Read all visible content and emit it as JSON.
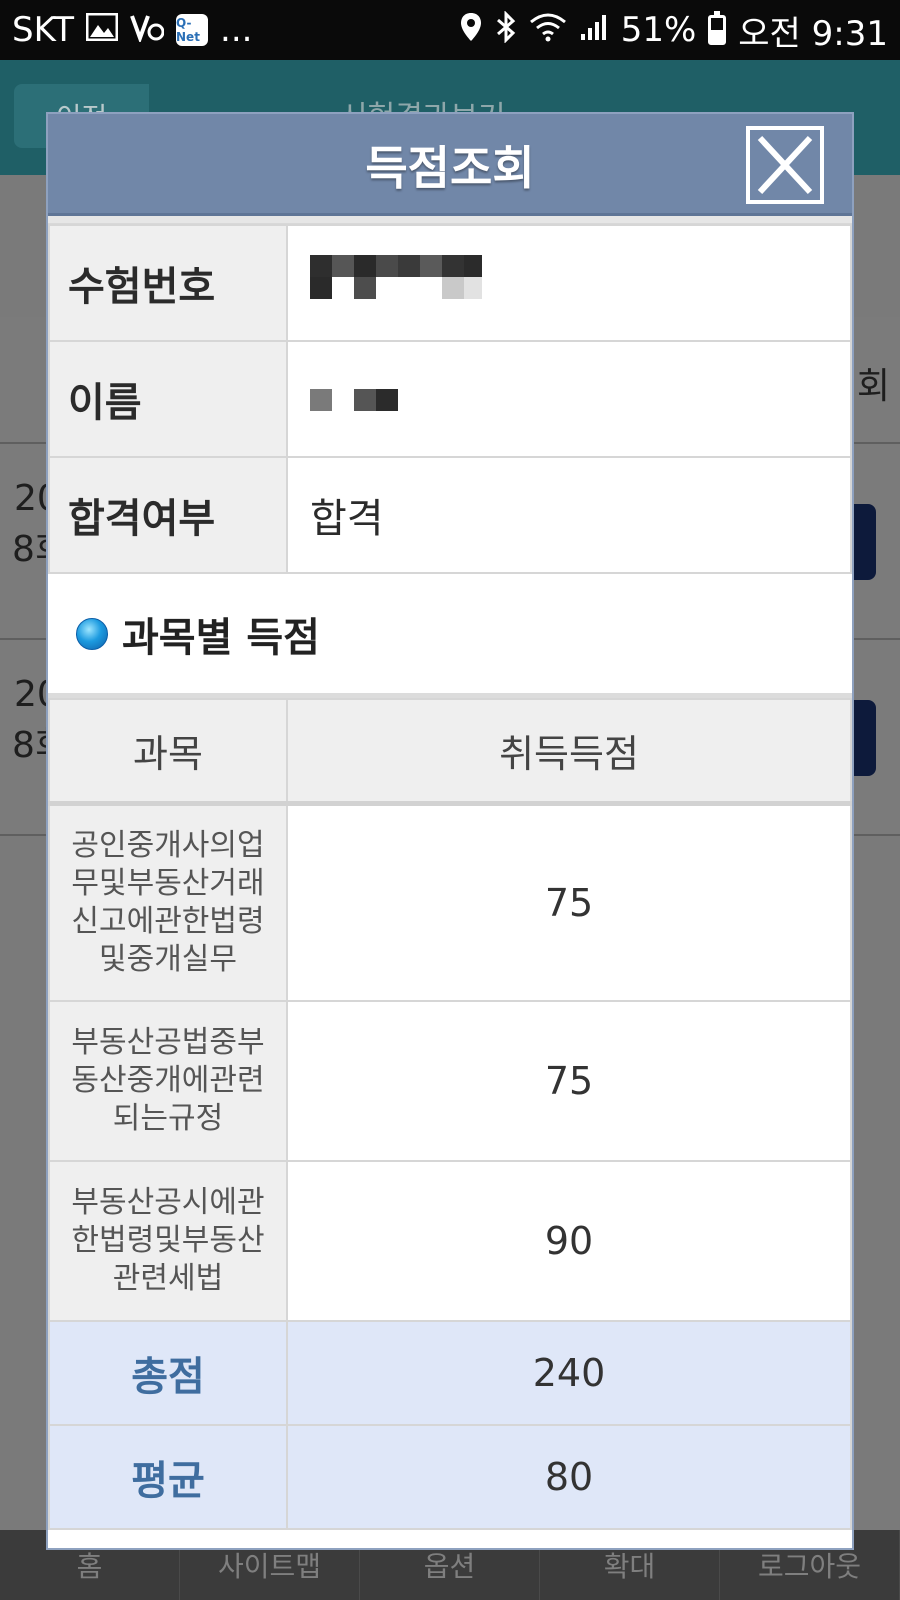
{
  "status_bar": {
    "carrier": "SKT",
    "battery": "51%",
    "time": "오전 9:31",
    "ellipsis": "...",
    "qnet_icon_label": "Q-Net",
    "battery_level": 0.51
  },
  "background": {
    "back_label": "이전",
    "title": "시험결과보기",
    "rows": [
      {
        "line1": "20",
        "line2": "8회"
      },
      {
        "line1": "20",
        "line2": "8회"
      }
    ],
    "right_fragment": "회",
    "bottom_nav": [
      "홈",
      "사이트맵",
      "옵션",
      "확대",
      "로그아웃"
    ]
  },
  "modal": {
    "title": "득점조회",
    "info": {
      "exam_number_label": "수험번호",
      "name_label": "이름",
      "pass_label": "합격여부",
      "pass_value": "합격"
    },
    "section_title": "과목별 득점",
    "score_table": {
      "headers": [
        "과목",
        "취득득점"
      ],
      "rows": [
        {
          "subject": "공인중개사의업무및부동산거래신고에관한법령및중개실무",
          "score": "75"
        },
        {
          "subject": "부동산공법중부동산중개에관련되는규정",
          "score": "75"
        },
        {
          "subject": "부동산공시에관한법령및부동산관련세법",
          "score": "90"
        }
      ],
      "total_label": "총점",
      "total_value": "240",
      "average_label": "평균",
      "average_value": "80"
    }
  },
  "colors": {
    "modal_header": "#7187a8",
    "summary_row_bg": "#dfe7f8",
    "summary_label": "#3f6d9f"
  }
}
